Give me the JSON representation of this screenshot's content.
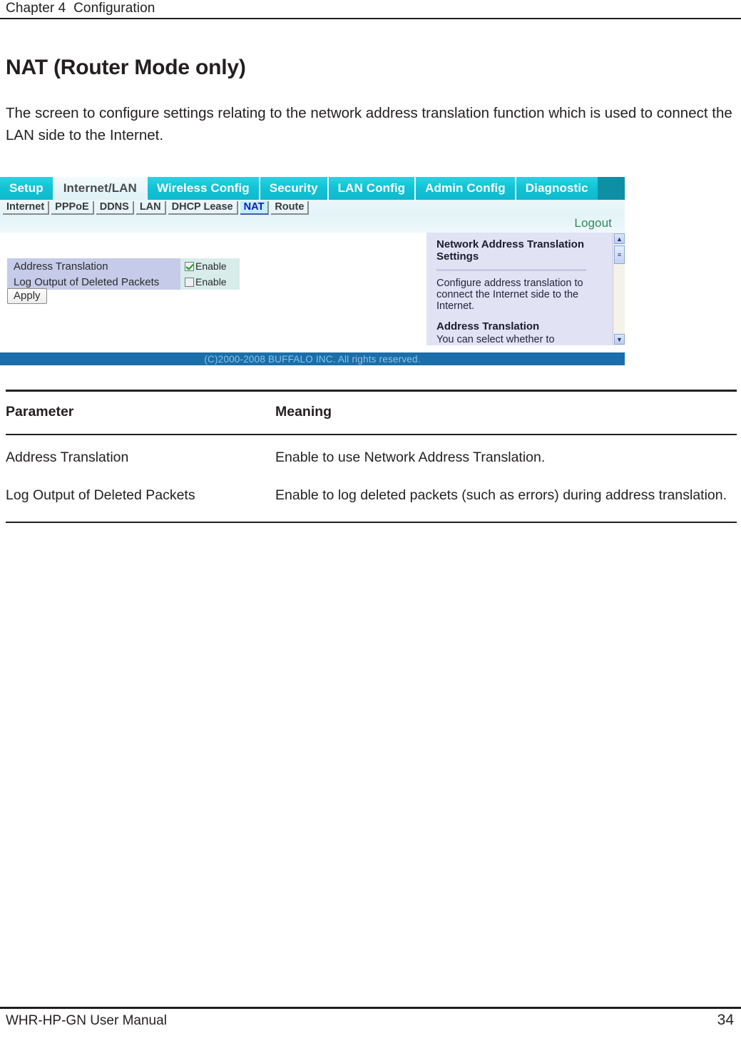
{
  "running_head": "Chapter 4  Configuration",
  "page_title": "NAT (Router Mode only)",
  "intro_paragraph": "The screen to configure settings relating to the network address translation function which is used to connect the LAN side to the Internet.",
  "screenshot": {
    "tabs": [
      {
        "label": "Setup",
        "active": false
      },
      {
        "label": "Internet/LAN",
        "active": true
      },
      {
        "label": "Wireless Config",
        "active": false
      },
      {
        "label": "Security",
        "active": false
      },
      {
        "label": "LAN Config",
        "active": false
      },
      {
        "label": "Admin Config",
        "active": false
      },
      {
        "label": "Diagnostic",
        "active": false
      }
    ],
    "subtabs": [
      {
        "label": "Internet",
        "active": false
      },
      {
        "label": "PPPoE",
        "active": false
      },
      {
        "label": "DDNS",
        "active": false
      },
      {
        "label": "LAN",
        "active": false
      },
      {
        "label": "DHCP Lease",
        "active": false
      },
      {
        "label": "NAT",
        "active": true
      },
      {
        "label": "Route",
        "active": false
      }
    ],
    "logout_label": "Logout",
    "settings": [
      {
        "label": "Address Translation",
        "checkbox_label": "Enable",
        "checked": true
      },
      {
        "label": "Log Output of Deleted Packets",
        "checkbox_label": "Enable",
        "checked": false
      }
    ],
    "apply_label": "Apply",
    "help": {
      "title": "Network Address Translation Settings",
      "paragraph": "Configure address translation to connect the Internet side to the Internet.",
      "subtitle": "Address Translation",
      "clipped_line": "You can select whether to [Enable]"
    },
    "scrollbar": {
      "up_glyph": "▲",
      "down_glyph": "▼",
      "thumb_glyph": "≡"
    },
    "copyright": "(C)2000-2008 BUFFALO INC. All rights reserved.",
    "colors": {
      "tab_cyan": "#13c3d6",
      "active_tab_bg": "#e6f5f9",
      "label_cell": "#c5cbe8",
      "value_cell": "#d8ecea",
      "help_panel": "#e2e2f5",
      "footer_bar": "#1b6ea8",
      "logout_green": "#2e8b57",
      "active_subtab_text": "#1515c8"
    }
  },
  "table": {
    "headers": {
      "parameter": "Parameter",
      "meaning": "Meaning"
    },
    "rows": [
      {
        "parameter": "Address Translation",
        "meaning": "Enable to use Network Address Translation."
      },
      {
        "parameter": "Log Output of Deleted Packets",
        "meaning": "Enable to log deleted packets (such as errors) during address translation."
      }
    ]
  },
  "footer": {
    "manual": "WHR-HP-GN User Manual",
    "page_number": "34"
  }
}
